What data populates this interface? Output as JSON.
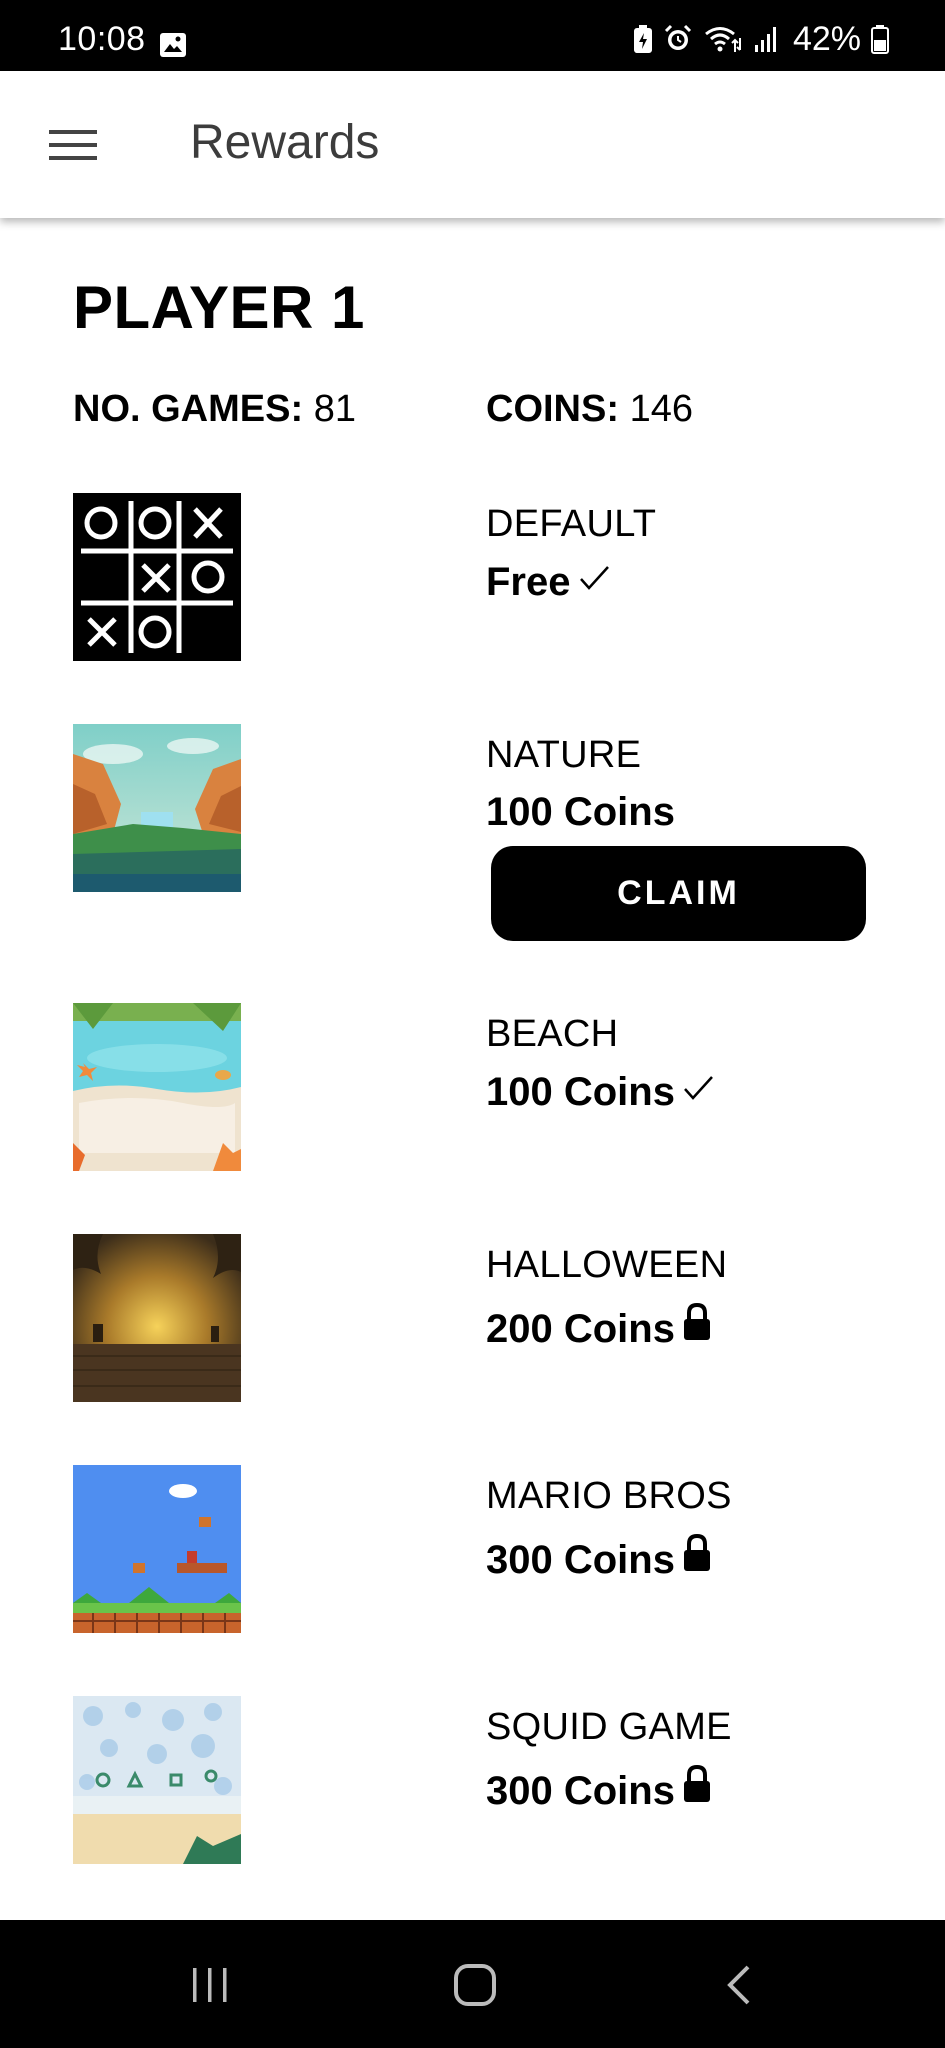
{
  "status_bar": {
    "time": "10:08",
    "battery_text": "42%",
    "icons": [
      "gallery-icon",
      "battery-saver-icon",
      "alarm-icon",
      "wifi-icon",
      "signal-icon",
      "battery-icon"
    ]
  },
  "app_bar": {
    "title": "Rewards",
    "menu_icon": "menu-icon"
  },
  "player": {
    "name": "PLAYER 1",
    "games_label": "NO. GAMES:",
    "games_value": "81",
    "coins_label": "COINS:",
    "coins_value": "146"
  },
  "rewards": [
    {
      "name": "DEFAULT",
      "price": "Free",
      "status": "owned",
      "status_icon": "checkmark-icon",
      "thumbnail": "tic-tac-toe-board"
    },
    {
      "name": "NATURE",
      "price": "100 Coins",
      "status": "claimable",
      "claim_label": "CLAIM",
      "thumbnail": "canyon-waterfall-landscape"
    },
    {
      "name": "BEACH",
      "price": "100 Coins",
      "status": "owned",
      "status_icon": "checkmark-icon",
      "thumbnail": "beach-sand-and-sea"
    },
    {
      "name": "HALLOWEEN",
      "price": "200 Coins",
      "status": "locked",
      "status_icon": "lock-icon",
      "thumbnail": "spooky-orange-sunset"
    },
    {
      "name": "MARIO BROS",
      "price": "300 Coins",
      "status": "locked",
      "status_icon": "lock-icon",
      "thumbnail": "pixel-platform-level"
    },
    {
      "name": "SQUID GAME",
      "price": "300 Coins",
      "status": "locked",
      "status_icon": "lock-icon",
      "thumbnail": "pastel-playground"
    }
  ],
  "nav_bar": {
    "buttons": [
      "recent-apps-icon",
      "home-icon",
      "back-icon"
    ]
  },
  "colors": {
    "background": "#ffffff",
    "bars": "#000000",
    "title_text": "#3c3c3c",
    "claim_button": "#000000"
  }
}
